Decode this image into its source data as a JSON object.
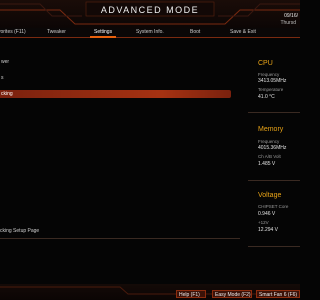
{
  "header": {
    "title": "ADVANCED MODE",
    "date": "09/16/",
    "day": "Thursd"
  },
  "tabs": [
    {
      "label": "vorites (F11)"
    },
    {
      "label": "Tweaker"
    },
    {
      "label": "Settings"
    },
    {
      "label": "System Info."
    },
    {
      "label": "Boot"
    },
    {
      "label": "Save & Exit"
    }
  ],
  "main": {
    "items": [
      {
        "label": "wer"
      },
      {
        "label": "s"
      },
      {
        "label": "cking"
      }
    ],
    "help_text": "cking Setup Page"
  },
  "sidebar": {
    "cpu": {
      "title": "CPU",
      "freq_label": "Frequency",
      "freq_value": "3413.05MHz",
      "temp_label": "Temperature",
      "temp_value": "41.0 °C"
    },
    "memory": {
      "title": "Memory",
      "freq_label": "Frequency",
      "freq_value": "4015.36MHz",
      "volt_label": "Ch A/B Volt",
      "volt_value": "1.485 V"
    },
    "voltage": {
      "title": "Voltage",
      "chipset_label": "CHIPSET Core",
      "chipset_value": "0.946 V",
      "v12_label": "+12V",
      "v12_value": "12.294 V"
    }
  },
  "footer": {
    "help": "Help (F1)",
    "easy_mode": "Easy Mode (F2)",
    "smart_fan": "Smart Fan 6 (F6)"
  },
  "colors": {
    "accent": "#e8600c",
    "selection": "#a63212",
    "section_title": "#e8a317"
  }
}
